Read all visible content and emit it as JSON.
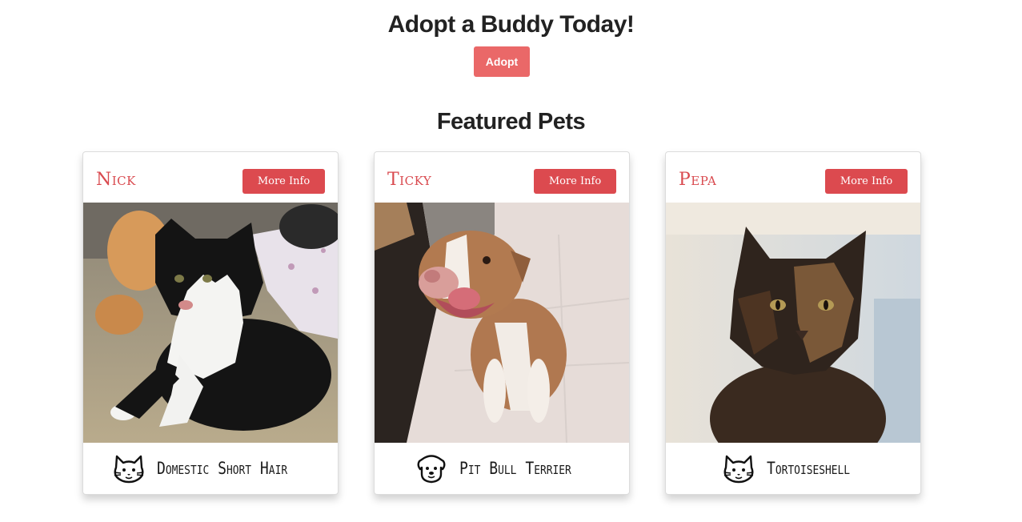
{
  "hero": {
    "title": "Adopt a Buddy Today!",
    "adopt_label": "Adopt"
  },
  "featured": {
    "title": "Featured Pets",
    "pets": [
      {
        "name": "Nick",
        "button": "More Info",
        "breed": "Domestic Short Hair",
        "icon": "cat-icon",
        "photo": "black-and-white-cat"
      },
      {
        "name": "Ticky",
        "button": "More Info",
        "breed": "Pit Bull Terrier",
        "icon": "dog-icon",
        "photo": "brown-and-white-pit-bull"
      },
      {
        "name": "Pepa",
        "button": "More Info",
        "breed": "Tortoiseshell",
        "icon": "cat-icon",
        "photo": "tortoiseshell-cat"
      }
    ]
  },
  "colors": {
    "adopt_button": "#ea6868",
    "more_info_button": "#dc4a4f",
    "pet_name": "#d94a4f"
  }
}
